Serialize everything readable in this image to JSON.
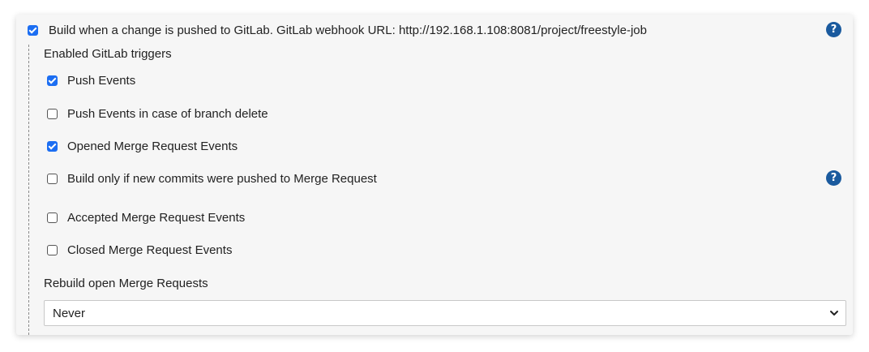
{
  "trigger": {
    "label": "Build when a change is pushed to GitLab. GitLab webhook URL: http://192.168.1.108:8081/project/freestyle-job",
    "checked": true,
    "help_glyph": "?"
  },
  "enabled_triggers": {
    "title": "Enabled GitLab triggers",
    "items": [
      {
        "label": "Push Events",
        "checked": true
      },
      {
        "label": "Push Events in case of branch delete",
        "checked": false
      },
      {
        "label": "Opened Merge Request Events",
        "checked": true
      },
      {
        "label": "Build only if new commits were pushed to Merge Request",
        "checked": false
      },
      {
        "label": "Accepted Merge Request Events",
        "checked": false
      },
      {
        "label": "Closed Merge Request Events",
        "checked": false
      }
    ],
    "help_glyph": "?"
  },
  "rebuild": {
    "title": "Rebuild open Merge Requests",
    "selected": "Never"
  },
  "colors": {
    "checkbox_checked": "#1c6ef2",
    "help_icon": "#1a5a9e",
    "panel_background": "#f6f6f6"
  },
  "icons": {
    "help": "question-circle-icon",
    "checkbox": "checkbox-icon",
    "dropdown": "chevron-down-icon"
  }
}
